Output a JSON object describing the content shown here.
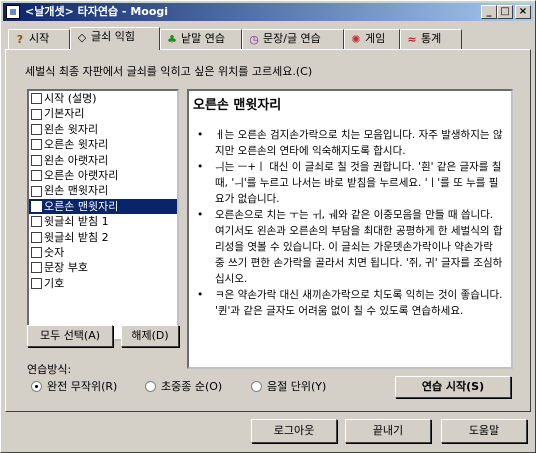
{
  "window": {
    "title": "<날개셋> 타자연습 - Moogi"
  },
  "titlebar_buttons": {
    "minimize": "_",
    "maximize": "□",
    "close": "×"
  },
  "tabs": [
    {
      "label": "시작",
      "icon": "question-icon",
      "glyph": "?"
    },
    {
      "label": "글쇠 익힘",
      "icon": "diamond-icon",
      "glyph": "◇"
    },
    {
      "label": "낱말 연습",
      "icon": "tree-icon",
      "glyph": "♣"
    },
    {
      "label": "문장/글 연습",
      "icon": "clock-icon",
      "glyph": "◷"
    },
    {
      "label": "게임",
      "icon": "wheel-icon",
      "glyph": "✺"
    },
    {
      "label": "통계",
      "icon": "chart-icon",
      "glyph": "≈"
    }
  ],
  "active_tab": 1,
  "instruction": "세벌식 최종 자판에서 글쇠를 익히고 싶은 위치를 고르세요.(C)",
  "list_items": [
    {
      "label": "시작 (설명)",
      "checked": false
    },
    {
      "label": "기본자리",
      "checked": false
    },
    {
      "label": "왼손 윗자리",
      "checked": false
    },
    {
      "label": "오른손 윗자리",
      "checked": false
    },
    {
      "label": "왼손 아랫자리",
      "checked": false
    },
    {
      "label": "오른손 아랫자리",
      "checked": false
    },
    {
      "label": "왼손 맨윗자리",
      "checked": false
    },
    {
      "label": "오른손 맨윗자리",
      "checked": false
    },
    {
      "label": "윗글쇠 받침 1",
      "checked": false
    },
    {
      "label": "윗글쇠 받침 2",
      "checked": false
    },
    {
      "label": "숫자",
      "checked": false
    },
    {
      "label": "문장 부호",
      "checked": false
    },
    {
      "label": "기호",
      "checked": false
    }
  ],
  "selected_index": 7,
  "buttons": {
    "select_all": "모두 선택(A)",
    "clear": "해제(D)",
    "start_practice": "연습 시작(S)",
    "logout": "로그아웃",
    "exit": "끝내기",
    "help": "도움말"
  },
  "content": {
    "heading": "오른손 맨윗자리",
    "bullets": [
      "ㅔ는 오른손 검지손가락으로 치는 모음입니다. 자주 발생하지는 않지만 오른손의 연타에 익숙해지도록 합시다.",
      "ㅢ는 ㅡ+ㅣ 대신 이 글쇠로 칠 것을 권합니다. '흰' 같은 글자를 칠 때, 'ㅢ'를 누르고 나서는 바로 받침을 누르세요. 'ㅣ'를 또 누를 필요가 없습니다.",
      "오른손으로 치는 ㅜ는 ㅟ, ㅞ와 같은 이중모음을 만들 때 씁니다. 여기서도 왼손과 오른손의 부담을 최대한 공평하게 한 세벌식의 합리성을 엿볼 수 있습니다. 이 글쇠는 가운뎃손가락이나 약손가락 중 쓰기 편한 손가락을 골라서 치면 됩니다. '쥐, 귀' 글자를 조심하십시오.",
      "ㅋ은 약손가락 대신 새끼손가락으로 치도록 익히는 것이 좋습니다. '퀸'과 같은 글자도 어려움 없이 칠 수 있도록 연습하세요."
    ]
  },
  "practice_mode": {
    "label": "연습방식:",
    "options": [
      "완전 무작위(R)",
      "초중종 순(O)",
      "음절 단위(Y)"
    ],
    "selected": 0
  }
}
